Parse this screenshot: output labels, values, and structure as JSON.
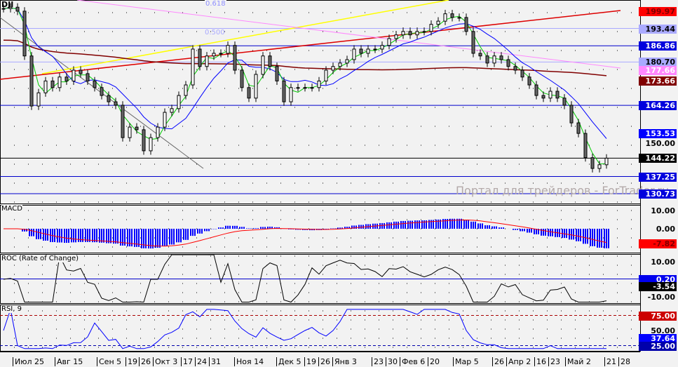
{
  "chart_data": {
    "type": "candlestick",
    "title": "DJI",
    "watermark": "Портал для трейдеров - ForTrader.ru",
    "closes": [
      201,
      201.5,
      200,
      183,
      164,
      169,
      173.5,
      171,
      175,
      173.5,
      177.6,
      176.3,
      173.5,
      171,
      168,
      165.6,
      164.3,
      152,
      156,
      155,
      147,
      152,
      156,
      161.6,
      163,
      168,
      172,
      185.6,
      179,
      183,
      184,
      184,
      187,
      177.6,
      171,
      167,
      176,
      183,
      179,
      173.5,
      165.6,
      171,
      171,
      171,
      171,
      173.5,
      177.6,
      179,
      180.3,
      181.6,
      185.6,
      184,
      185.6,
      185.6,
      187,
      189.6,
      191,
      192.3,
      191,
      192.3,
      192.3,
      195,
      196.2,
      199,
      197.6,
      197.6,
      192.3,
      184,
      183,
      180.3,
      183,
      181.6,
      179,
      177.6,
      175,
      172,
      168,
      167,
      169.6,
      167,
      164.3,
      157.6,
      153.6,
      144.4,
      140.3,
      141.7,
      144.2
    ],
    "ylim": [
      129,
      203
    ],
    "price_labels": [
      {
        "value": "199.97",
        "bg": "#ff0000",
        "fg": "#800000"
      },
      {
        "value": "193.44",
        "bg": "#aaaaff",
        "fg": "#000000"
      },
      {
        "value": "186.86",
        "bg": "#0000dd",
        "fg": "#ffffff"
      },
      {
        "value": "180.70",
        "bg": "#aaaaff",
        "fg": "#000000"
      },
      {
        "value": "177.66",
        "bg": "#ff88ff",
        "fg": "#ffffff"
      },
      {
        "value": "173.66",
        "bg": "#800000",
        "fg": "#ffffff"
      },
      {
        "value": "164.26",
        "bg": "#0000dd",
        "fg": "#ffffff"
      },
      {
        "value": "153.53",
        "bg": "#0000ff",
        "fg": "#ffffff"
      },
      {
        "value": "150.00",
        "bg": "transparent",
        "fg": "#000000"
      },
      {
        "value": "144.22",
        "bg": "#000000",
        "fg": "#ffffff"
      },
      {
        "value": "137.25",
        "bg": "#0000dd",
        "fg": "#ffffff"
      },
      {
        "value": "130.73",
        "bg": "#0000dd",
        "fg": "#ffffff"
      }
    ],
    "hlines": [
      {
        "v": 193.44,
        "c": "#aaaaff"
      },
      {
        "v": 186.86,
        "c": "#0000cc"
      },
      {
        "v": 180.7,
        "c": "#aaaaff"
      },
      {
        "v": 164.26,
        "c": "#0000cc"
      },
      {
        "v": 144.22,
        "c": "#000000"
      },
      {
        "v": 137.25,
        "c": "#0000cc"
      },
      {
        "v": 130.73,
        "c": "#0000cc"
      }
    ],
    "fib_labels": [
      "0.618",
      "0.500"
    ],
    "x_ticks": [
      {
        "i": 1.5,
        "label": "Июл 25"
      },
      {
        "i": 7.5,
        "label": "Авг 15"
      },
      {
        "i": 13.5,
        "label": "Сен 5"
      },
      {
        "i": 17.6,
        "label": "19"
      },
      {
        "i": 19.5,
        "label": "26"
      },
      {
        "i": 21.5,
        "label": "Окт 3"
      },
      {
        "i": 25.5,
        "label": "17"
      },
      {
        "i": 27.5,
        "label": "24"
      },
      {
        "i": 29.5,
        "label": "31"
      },
      {
        "i": 33.1,
        "label": "Ноя 14"
      },
      {
        "i": 39.1,
        "label": "Дек 5"
      },
      {
        "i": 43.1,
        "label": "19"
      },
      {
        "i": 45.1,
        "label": "26"
      },
      {
        "i": 47.1,
        "label": "Янв 3"
      },
      {
        "i": 52.7,
        "label": "23"
      },
      {
        "i": 54.7,
        "label": "30"
      },
      {
        "i": 56.7,
        "label": "Фев 6"
      },
      {
        "i": 60.7,
        "label": "20"
      },
      {
        "i": 64.3,
        "label": "Мар 5"
      },
      {
        "i": 69.9,
        "label": "26"
      },
      {
        "i": 71.9,
        "label": "Апр 2"
      },
      {
        "i": 75.9,
        "label": "16"
      },
      {
        "i": 77.9,
        "label": "23"
      },
      {
        "i": 80.3,
        "label": "Май 2"
      },
      {
        "i": 85.9,
        "label": "21"
      },
      {
        "i": 87.9,
        "label": "28"
      }
    ],
    "panels": {
      "macd": {
        "title": "MACD",
        "ticks": [
          "10.00",
          "0.00"
        ],
        "value": "-7.82"
      },
      "roc": {
        "title": "ROC (Rate of Change)",
        "ticks": [
          "10.00",
          "-10.00"
        ],
        "level": "0.20",
        "value": "-3.54"
      },
      "rsi": {
        "title": "RSI, 9",
        "ticks": [
          "50.00"
        ],
        "upper": "75.00",
        "lower": "25.00",
        "value": "37.64"
      }
    }
  }
}
